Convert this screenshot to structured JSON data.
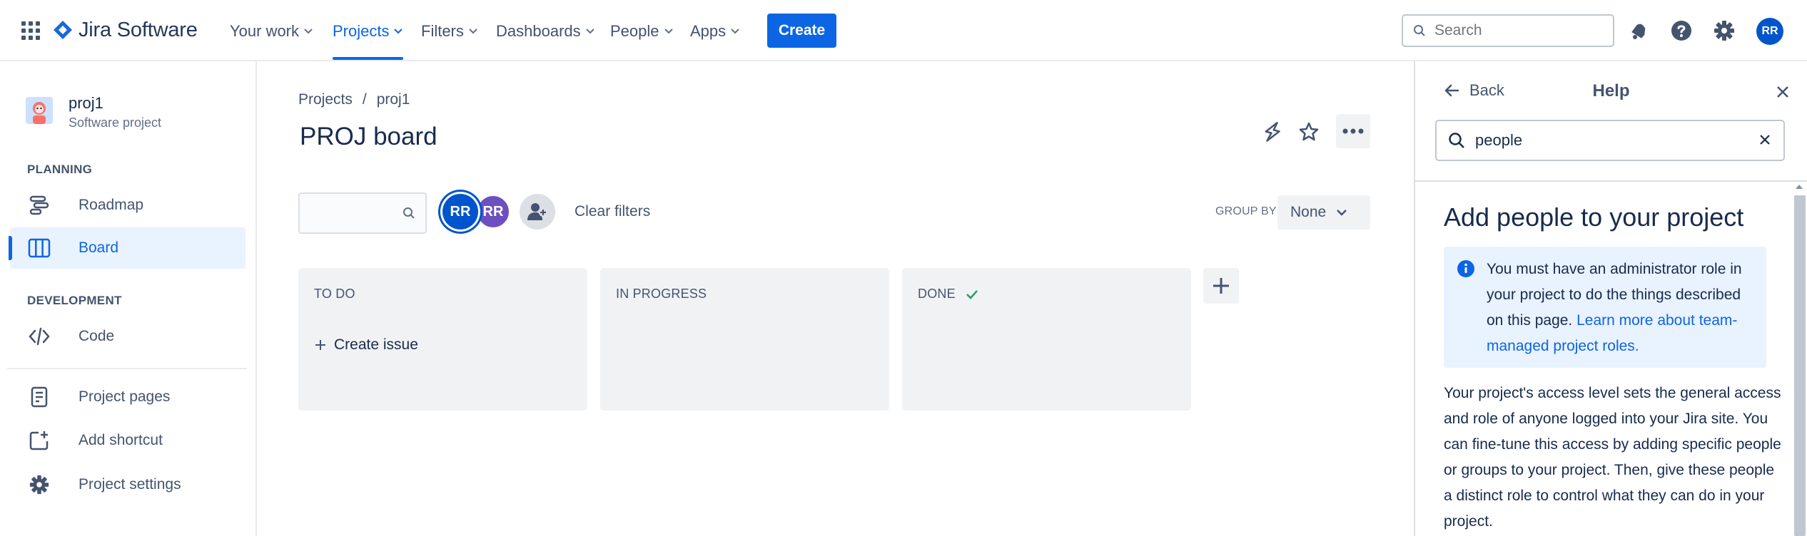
{
  "nav": {
    "logo_text": "Jira Software",
    "items": [
      {
        "label": "Your work"
      },
      {
        "label": "Projects"
      },
      {
        "label": "Filters"
      },
      {
        "label": "Dashboards"
      },
      {
        "label": "People"
      },
      {
        "label": "Apps"
      }
    ],
    "create_label": "Create",
    "search_placeholder": "Search",
    "avatar_initials": "RR",
    "accent_color": "#0c66e4"
  },
  "sidebar": {
    "project_name": "proj1",
    "project_type": "Software project",
    "planning_label": "PLANNING",
    "development_label": "DEVELOPMENT",
    "items": {
      "roadmap": "Roadmap",
      "board": "Board",
      "code": "Code",
      "project_pages": "Project pages",
      "add_shortcut": "Add shortcut",
      "project_settings": "Project settings"
    },
    "icons": [
      "roadmap-icon",
      "board-icon",
      "code-icon",
      "project-pages-icon",
      "add-shortcut-icon",
      "gear-icon"
    ]
  },
  "board": {
    "breadcrumb": [
      "Projects",
      "/",
      "proj1"
    ],
    "title": "PROJ board",
    "avatars": [
      "RR",
      "RR"
    ],
    "clear_filters": "Clear filters",
    "group_by_label": "GROUP BY",
    "group_by_value": "None",
    "columns": [
      {
        "title": "TO DO"
      },
      {
        "title": "IN PROGRESS"
      },
      {
        "title": "DONE"
      }
    ],
    "create_issue": "Create issue"
  },
  "help": {
    "back_label": "Back",
    "title": "Help",
    "search_value": "people",
    "heading": "Add people to your project",
    "info_text": "You must have an administrator role in your project to do the things described on this page. ",
    "info_link": "Learn more about team-managed project roles.",
    "body": "Your project's access level sets the general access and role of anyone logged into your Jira site. You can fine-tune this access by adding specific people or groups to your project. Then, give these people a distinct role to control what they can do in your project."
  }
}
